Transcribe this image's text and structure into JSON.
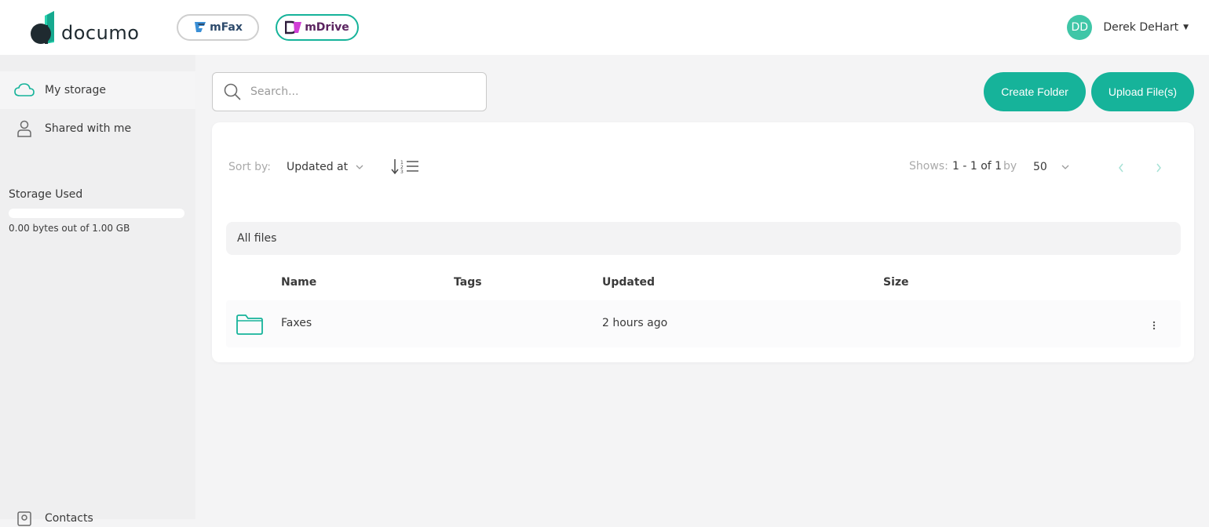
{
  "brand": {
    "name": "documo"
  },
  "apps": [
    {
      "label": "mFax"
    },
    {
      "label": "mDrive"
    }
  ],
  "user": {
    "initials": "DD",
    "name": "Derek DeHart"
  },
  "sidebar": {
    "items": [
      {
        "label": "My storage",
        "icon": "cloud-icon"
      },
      {
        "label": "Shared with me",
        "icon": "person-icon"
      }
    ],
    "storage": {
      "title": "Storage Used",
      "summary": "0.00 bytes out of 1.00 GB",
      "used_fraction": 0
    },
    "bottom_item": {
      "label": "Contacts",
      "icon": "contacts-icon"
    }
  },
  "search": {
    "placeholder": "Search..."
  },
  "actions": {
    "create_folder": "Create Folder",
    "upload_files": "Upload File(s)"
  },
  "toolbar": {
    "sort_label": "Sort by:",
    "sort_value": "Updated at",
    "shows_label": "Shows:",
    "shows_value": "1 - 1 of 1",
    "by_label": "by",
    "per_page": "50"
  },
  "section": {
    "title": "All files"
  },
  "table": {
    "columns": [
      "Name",
      "Tags",
      "Updated",
      "Size"
    ],
    "rows": [
      {
        "name": "Faxes",
        "tags": "",
        "updated": "2 hours ago",
        "size": "",
        "type": "folder"
      }
    ]
  },
  "colors": {
    "accent": "#16b39a",
    "avatar": "#3fc6a7"
  }
}
